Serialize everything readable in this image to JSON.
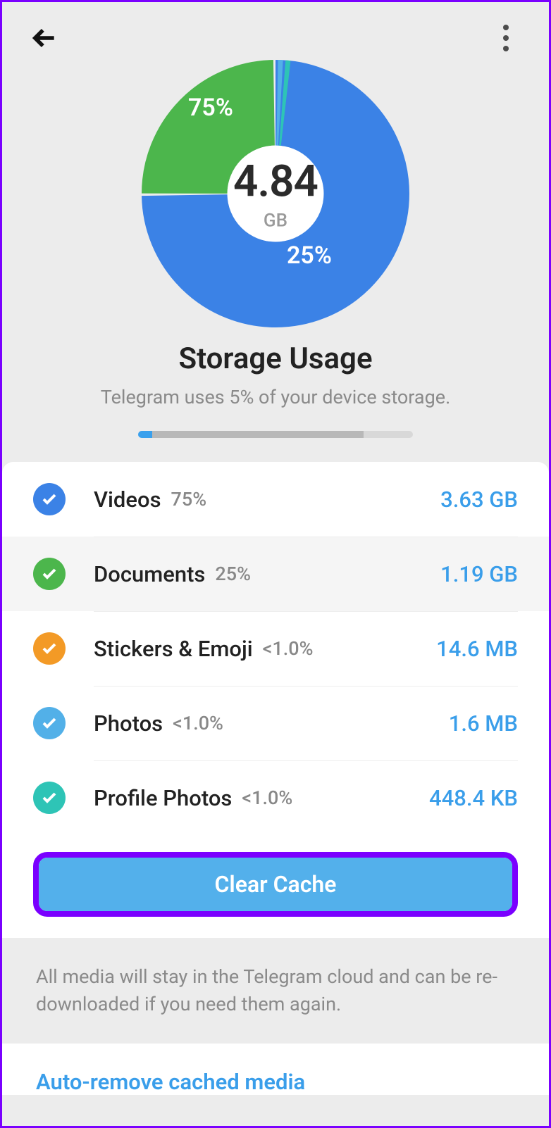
{
  "center_value": "4.84",
  "center_unit": "GB",
  "title": "Storage Usage",
  "subtitle": "Telegram uses 5% of your device storage.",
  "progress": {
    "used_pct": 5
  },
  "chart_data": {
    "type": "pie",
    "title": "Storage Usage",
    "total_value": 4.84,
    "total_unit": "GB",
    "series": [
      {
        "name": "Videos",
        "pct": 75,
        "size": "3.63 GB",
        "color": "#3b82e6",
        "label_shown": "75%"
      },
      {
        "name": "Documents",
        "pct": 25,
        "size": "1.19 GB",
        "color": "#4cb64c",
        "label_shown": "25%"
      },
      {
        "name": "Stickers & Emoji",
        "pct": 0.9,
        "size": "14.6 MB",
        "color": "#f39a26"
      },
      {
        "name": "Photos",
        "pct": 0.9,
        "size": "1.6 MB",
        "color": "#52b0e8"
      },
      {
        "name": "Profile Photos",
        "pct": 0.9,
        "size": "448.4 KB",
        "color": "#2ec4b6"
      }
    ]
  },
  "rows": [
    {
      "label": "Videos",
      "pct": "75%",
      "size": "3.63 GB",
      "color": "#3b82e6",
      "highlight": false
    },
    {
      "label": "Documents",
      "pct": "25%",
      "size": "1.19 GB",
      "color": "#4cb64c",
      "highlight": true
    },
    {
      "label": "Stickers & Emoji",
      "pct": "<1.0%",
      "size": "14.6 MB",
      "color": "#f39a26",
      "highlight": false
    },
    {
      "label": "Photos",
      "pct": "<1.0%",
      "size": "1.6 MB",
      "color": "#52b0e8",
      "highlight": false
    },
    {
      "label": "Profile Photos",
      "pct": "<1.0%",
      "size": "448.4 KB",
      "color": "#2ec4b6",
      "highlight": false
    }
  ],
  "clear_label": "Clear Cache",
  "footer_note": "All media will stay in the Telegram cloud and can be re-downloaded if you need them again.",
  "auto_remove_title": "Auto-remove cached media"
}
